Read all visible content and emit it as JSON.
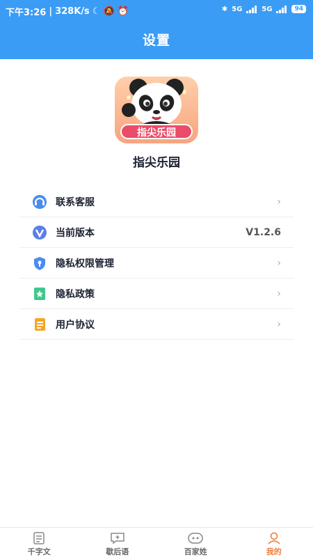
{
  "status_bar": {
    "time": "下午3:26",
    "speed": "328K/s",
    "network1": "5G",
    "network2": "5G",
    "battery": "94"
  },
  "header": {
    "title": "设置"
  },
  "app": {
    "logo_text": "指尖乐园",
    "name": "指尖乐园"
  },
  "menu": [
    {
      "label": "联系客服",
      "icon": "customer-service-icon"
    },
    {
      "label": "当前版本",
      "icon": "version-icon",
      "value": "V1.2.6"
    },
    {
      "label": "隐私权限管理",
      "icon": "privacy-shield-icon"
    },
    {
      "label": "隐私政策",
      "icon": "privacy-policy-icon"
    },
    {
      "label": "用户协议",
      "icon": "user-agreement-icon"
    }
  ],
  "tabs": [
    {
      "label": "千字文",
      "icon": "document-icon"
    },
    {
      "label": "歇后语",
      "icon": "chat-bubble-icon"
    },
    {
      "label": "百家姓",
      "icon": "face-icon"
    },
    {
      "label": "我的",
      "icon": "person-icon",
      "active": true
    }
  ],
  "colors": {
    "primary": "#3a9cf5",
    "active_tab": "#ef7d3c",
    "logo_label": "#e94d69"
  }
}
